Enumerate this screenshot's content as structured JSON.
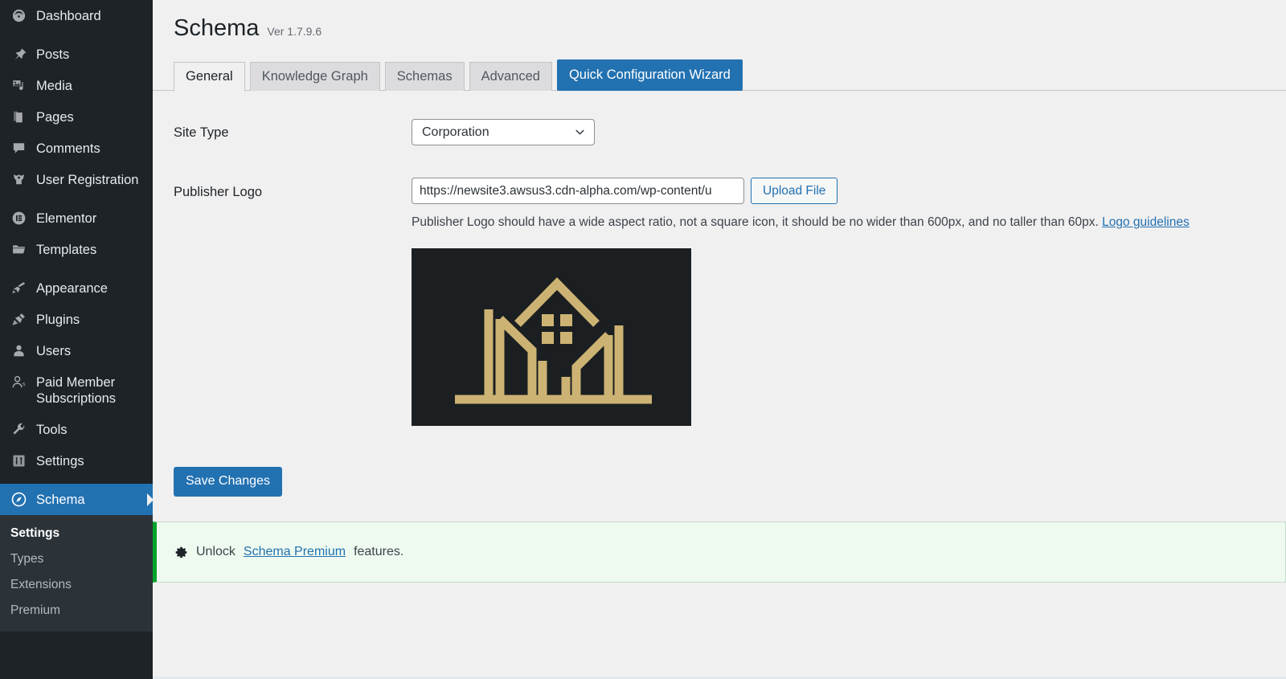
{
  "sidebar": {
    "groups": [
      {
        "items": [
          {
            "label": "Dashboard",
            "icon": "dashboard-icon",
            "name": "sidebar-item-dashboard"
          }
        ]
      },
      {
        "items": [
          {
            "label": "Posts",
            "icon": "pin-icon",
            "name": "sidebar-item-posts"
          },
          {
            "label": "Media",
            "icon": "media-icon",
            "name": "sidebar-item-media"
          },
          {
            "label": "Pages",
            "icon": "pages-icon",
            "name": "sidebar-item-pages"
          },
          {
            "label": "Comments",
            "icon": "comment-icon",
            "name": "sidebar-item-comments"
          },
          {
            "label": "User Registration",
            "icon": "user-registration-icon",
            "name": "sidebar-item-user-registration"
          }
        ]
      },
      {
        "items": [
          {
            "label": "Elementor",
            "icon": "elementor-icon",
            "name": "sidebar-item-elementor"
          },
          {
            "label": "Templates",
            "icon": "folder-icon",
            "name": "sidebar-item-templates"
          }
        ]
      },
      {
        "items": [
          {
            "label": "Appearance",
            "icon": "paintbrush-icon",
            "name": "sidebar-item-appearance"
          },
          {
            "label": "Plugins",
            "icon": "plug-icon",
            "name": "sidebar-item-plugins"
          },
          {
            "label": "Users",
            "icon": "user-icon",
            "name": "sidebar-item-users"
          },
          {
            "label": "Paid Member Subscriptions",
            "icon": "member-dollar-icon",
            "name": "sidebar-item-paid-member-subscriptions"
          },
          {
            "label": "Tools",
            "icon": "wrench-icon",
            "name": "sidebar-item-tools"
          },
          {
            "label": "Settings",
            "icon": "sliders-icon",
            "name": "sidebar-item-settings"
          }
        ]
      }
    ],
    "current": {
      "label": "Schema",
      "icon": "compass-icon",
      "name": "sidebar-item-schema"
    },
    "submenu": [
      {
        "label": "Settings",
        "current": true,
        "name": "submenu-item-settings"
      },
      {
        "label": "Types",
        "current": false,
        "name": "submenu-item-types"
      },
      {
        "label": "Extensions",
        "current": false,
        "name": "submenu-item-extensions"
      },
      {
        "label": "Premium",
        "current": false,
        "name": "submenu-item-premium"
      }
    ]
  },
  "header": {
    "title": "Schema",
    "version": "Ver 1.7.9.6"
  },
  "tabs": [
    {
      "label": "General",
      "state": "active",
      "name": "tab-general"
    },
    {
      "label": "Knowledge Graph",
      "state": "normal",
      "name": "tab-knowledge-graph"
    },
    {
      "label": "Schemas",
      "state": "normal",
      "name": "tab-schemas"
    },
    {
      "label": "Advanced",
      "state": "normal",
      "name": "tab-advanced"
    },
    {
      "label": "Quick Configuration Wizard",
      "state": "primary",
      "name": "tab-quick-configuration-wizard"
    }
  ],
  "form": {
    "site_type": {
      "label": "Site Type",
      "value": "Corporation"
    },
    "publisher_logo": {
      "label": "Publisher Logo",
      "value": "https://newsite3.awsus3.cdn-alpha.com/wp-content/u",
      "placeholder": "",
      "upload_button": "Upload File",
      "help_text": "Publisher Logo should have a wide aspect ratio, not a square icon, it should be no wider than 600px, and no taller than 60px.",
      "help_link": "Logo guidelines"
    },
    "save_button": "Save Changes"
  },
  "notice": {
    "prefix": "Unlock",
    "link": "Schema Premium",
    "suffix": "features."
  },
  "colors": {
    "accent_blue": "#2271b1",
    "sidebar_bg": "#1d2327",
    "submenu_bg": "#2c3338",
    "notice_green": "#00a32a",
    "notice_bg": "#eefaf0",
    "logo_gold": "#cdb373",
    "logo_bg": "#1b1f22"
  }
}
